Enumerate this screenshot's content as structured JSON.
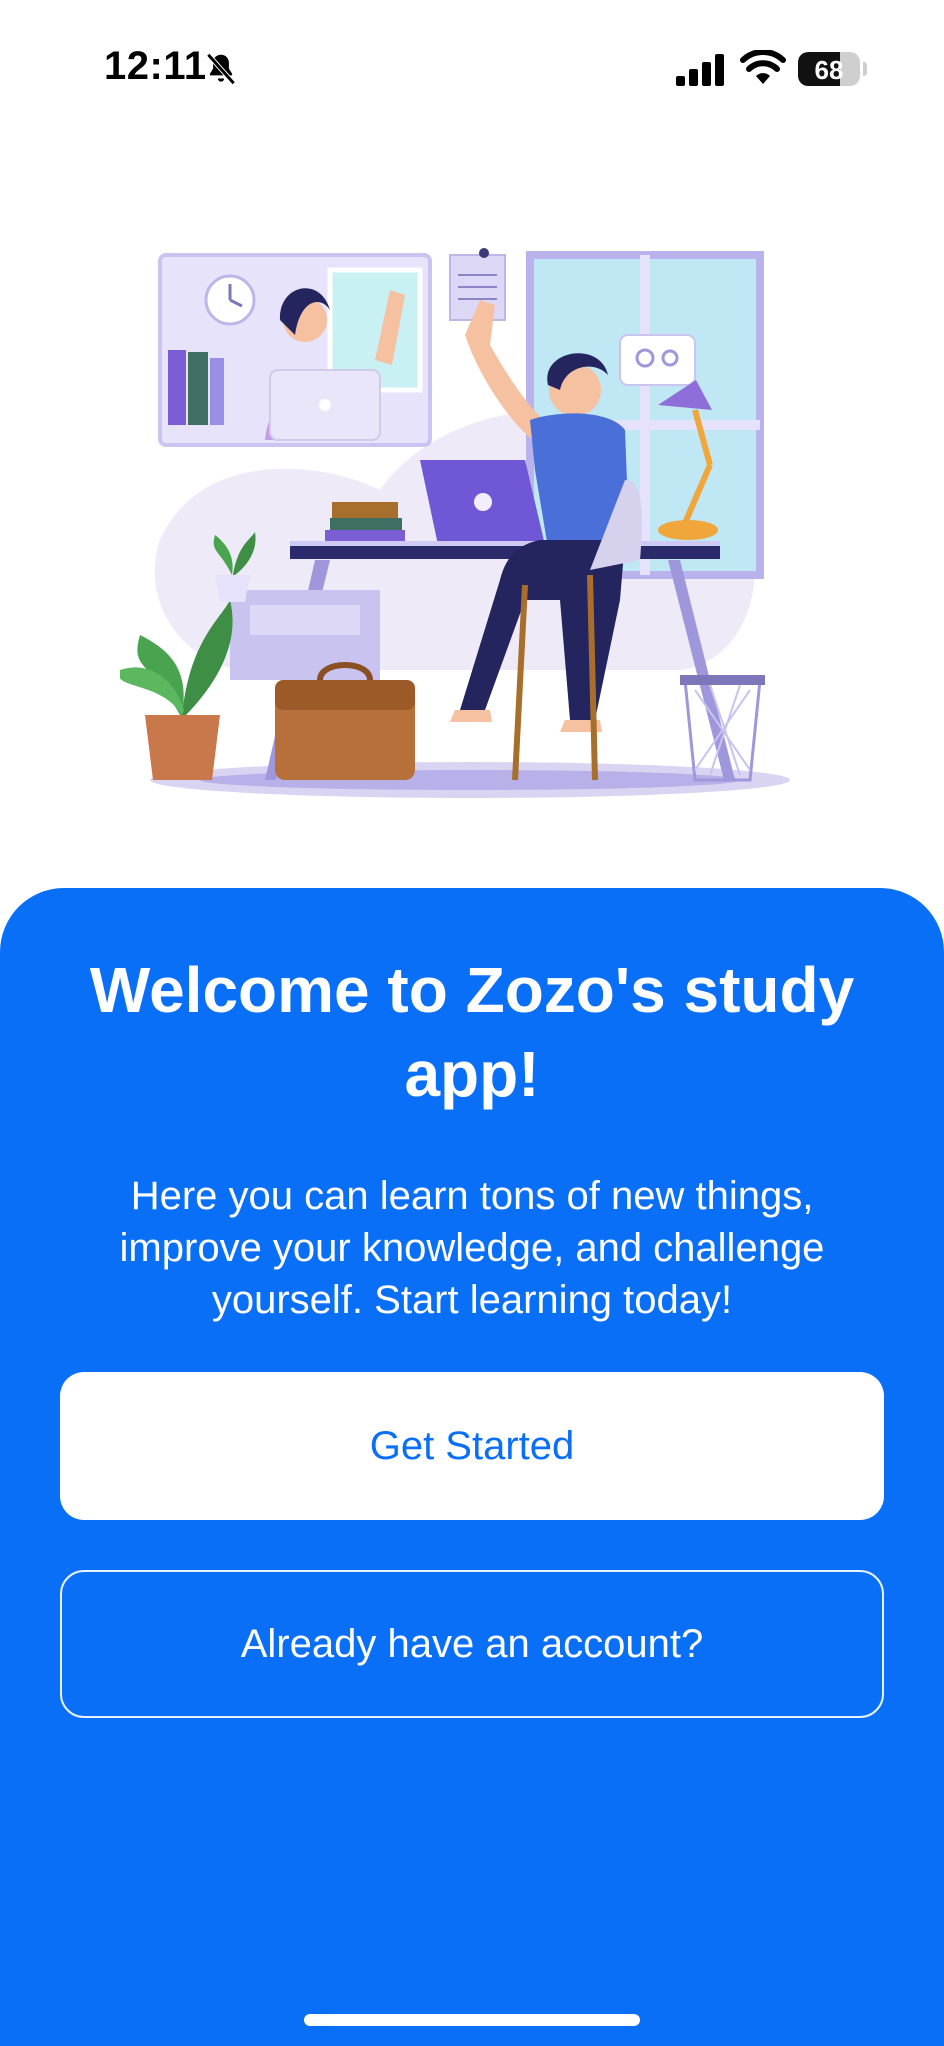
{
  "status_bar": {
    "time": "12:11",
    "battery_level": "68",
    "battery_fraction": 0.68,
    "icons": [
      "bell-slash-icon",
      "cellular-signal-icon",
      "wifi-icon",
      "battery-icon"
    ]
  },
  "illustration": {
    "icon": "study-illustration"
  },
  "welcome": {
    "title": "Welcome to Zozo's study app!",
    "subtitle": "Here you can learn tons of new things, improve your knowledge, and challenge yourself. Start learning today!"
  },
  "actions": {
    "get_started_label": "Get Started",
    "login_label": "Already have an account?"
  },
  "colors": {
    "accent": "#0a6ff7",
    "text_on_accent": "#ffffff"
  }
}
